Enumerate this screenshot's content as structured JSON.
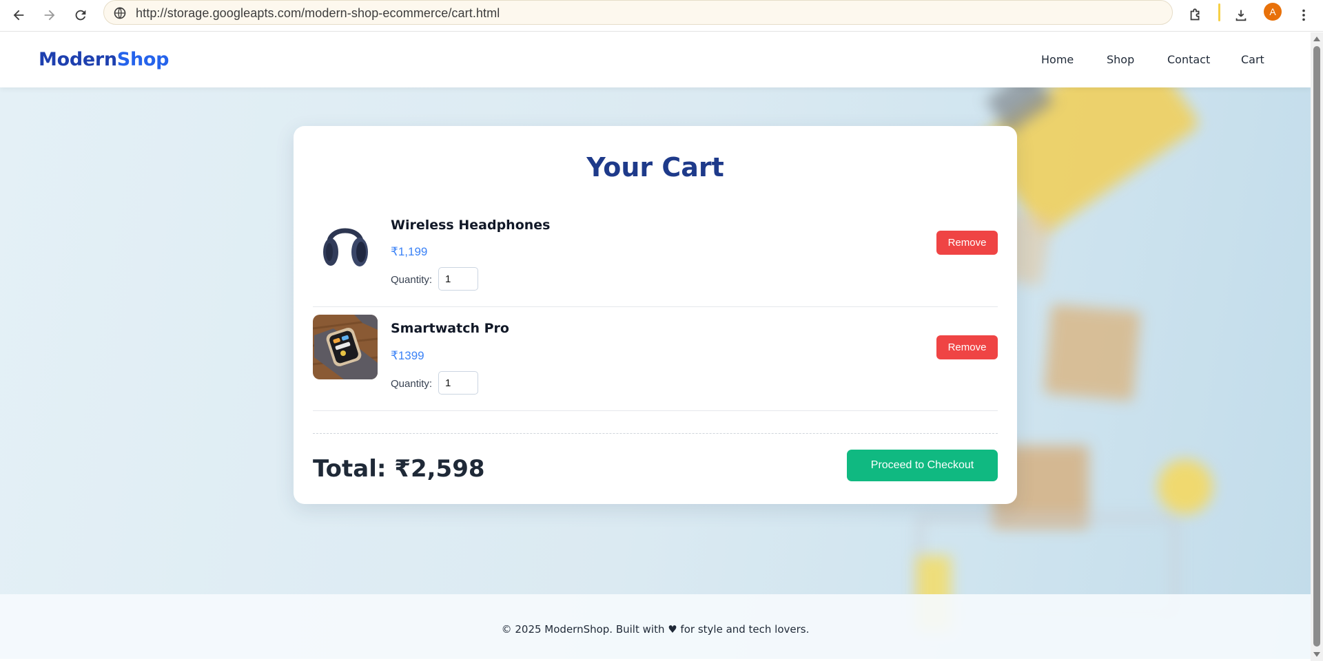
{
  "browser": {
    "url": "http://storage.googleapts.com/modern-shop-ecommerce/cart.html",
    "profile_initial": "A",
    "icons": [
      "back-arrow-icon",
      "forward-arrow-icon",
      "reload-icon",
      "site-info-icon",
      "extensions-icon",
      "download-icon",
      "more-vert-icon"
    ]
  },
  "header": {
    "logo_part1": "Modern",
    "logo_part2": "Shop",
    "nav": [
      "Home",
      "Shop",
      "Contact",
      "Cart"
    ]
  },
  "cart": {
    "title": "Your Cart",
    "items": [
      {
        "name": "Wireless Headphones",
        "price": "₹1,199",
        "quantity_label": "Quantity:",
        "quantity": "1",
        "remove_label": "Remove",
        "image": "headphones-image"
      },
      {
        "name": "Smartwatch Pro",
        "price": "₹1399",
        "quantity_label": "Quantity:",
        "quantity": "1",
        "remove_label": "Remove",
        "image": "smartwatch-image"
      }
    ],
    "total": "Total: ₹2,598",
    "checkout_label": "Proceed to Checkout"
  },
  "footer": {
    "text": "© 2025 ModernShop. Built with ♥ for style and tech lovers."
  },
  "colors": {
    "brand_dark": "#1e40af",
    "brand": "#2563eb",
    "title": "#1e3a8a",
    "price": "#3b82f6",
    "remove": "#ef4444",
    "checkout": "#10b981"
  }
}
